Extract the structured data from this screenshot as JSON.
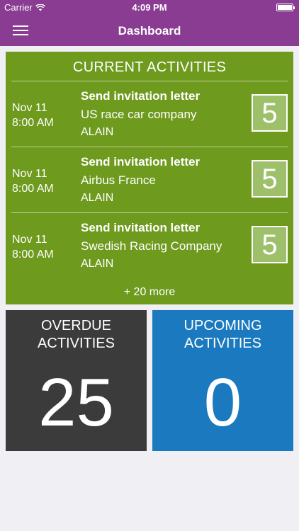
{
  "status": {
    "carrier": "Carrier",
    "time": "4:09 PM"
  },
  "nav": {
    "title": "Dashboard"
  },
  "current": {
    "title": "CURRENT ACTIVITIES",
    "items": [
      {
        "date": "Nov 11",
        "time": "8:00 AM",
        "title": "Send invitation letter",
        "company": "US race car company",
        "owner": "ALAIN",
        "badge": "5"
      },
      {
        "date": "Nov 11",
        "time": "8:00 AM",
        "title": "Send invitation letter",
        "company": "Airbus France",
        "owner": "ALAIN",
        "badge": "5"
      },
      {
        "date": "Nov 11",
        "time": "8:00 AM",
        "title": "Send invitation letter",
        "company": "Swedish Racing Company",
        "owner": "ALAIN",
        "badge": "5"
      }
    ],
    "more": "+ 20 more"
  },
  "overdue": {
    "line1": "OVERDUE",
    "line2": "ACTIVITIES",
    "count": "25"
  },
  "upcoming": {
    "line1": "UPCOMING",
    "line2": "ACTIVITIES",
    "count": "0"
  },
  "colors": {
    "brand": "#8a3c92",
    "current": "#6e9a1e",
    "badge": "#9ec06a",
    "overdue": "#3b3b3b",
    "upcoming": "#1b7abf"
  }
}
